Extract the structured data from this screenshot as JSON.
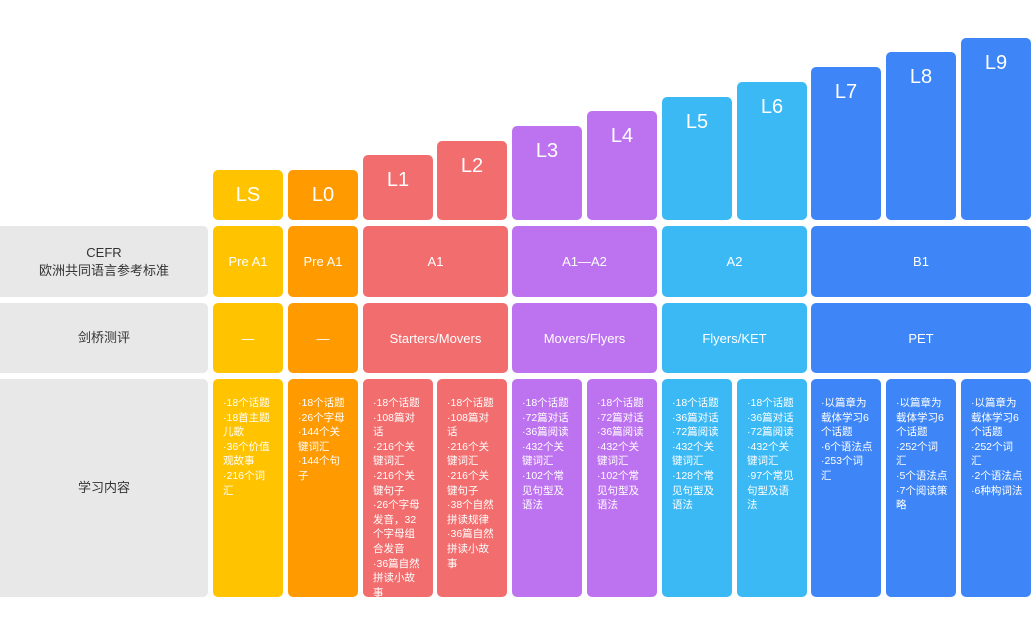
{
  "row_labels": {
    "cefr": "CEFR\n欧洲共同语言参考标准",
    "cambridge": "剑桥测评",
    "content": "学习内容"
  },
  "colors": {
    "yellow": "#FFC300",
    "orange": "#FF9A00",
    "red": "#F26D6D",
    "purple": "#BD73F0",
    "cyan": "#3BB9F5",
    "blue": "#3E86F7",
    "label_bg": "#E8E8E8"
  },
  "levels": [
    {
      "name": "LS",
      "color": "#FFC300",
      "content": "·18个话题\n·18首主题儿歌\n·36个价值观故事\n·216个词汇"
    },
    {
      "name": "L0",
      "color": "#FF9A00",
      "content": "·18个话题\n·26个字母\n·144个关键词汇\n·144个句子"
    },
    {
      "name": "L1",
      "color": "#F26D6D",
      "content": "·18个话题\n·108篇对话\n·216个关键词汇\n·216个关键句子\n·26个字母发音，32个字母组合发音\n·36篇自然拼读小故事"
    },
    {
      "name": "L2",
      "color": "#F26D6D",
      "content": "·18个话题\n·108篇对话\n·216个关键词汇\n·216个关键句子\n·38个自然拼读规律\n·36篇自然拼读小故事"
    },
    {
      "name": "L3",
      "color": "#BD73F0",
      "content": "·18个话题\n·72篇对话\n·36篇阅读\n·432个关键词汇\n·102个常见句型及语法"
    },
    {
      "name": "L4",
      "color": "#BD73F0",
      "content": "·18个话题\n·72篇对话\n·36篇阅读\n·432个关键词汇\n·102个常见句型及语法"
    },
    {
      "name": "L5",
      "color": "#3BB9F5",
      "content": "·18个话题\n·36篇对话\n·72篇阅读\n·432个关键词汇\n·128个常见句型及语法"
    },
    {
      "name": "L6",
      "color": "#3BB9F5",
      "content": "·18个话题\n·36篇对话\n·72篇阅读\n·432个关键词汇\n·97个常见句型及语法"
    },
    {
      "name": "L7",
      "color": "#3E86F7",
      "content": "·以篇章为载体学习6个话题\n·6个语法点\n·253个词汇"
    },
    {
      "name": "L8",
      "color": "#3E86F7",
      "content": "·以篇章为载体学习6个话题\n·252个词汇\n·5个语法点\n·7个阅读策略"
    },
    {
      "name": "L9",
      "color": "#3E86F7",
      "content": "·以篇章为载体学习6个话题\n·252个词汇\n·2个语法点\n·6种构词法"
    }
  ],
  "cefr": [
    {
      "label": "Pre A1",
      "start": 0,
      "span": 1,
      "color": "#FFC300"
    },
    {
      "label": "Pre A1",
      "start": 1,
      "span": 1,
      "color": "#FF9A00"
    },
    {
      "label": "A1",
      "start": 2,
      "span": 2,
      "color": "#F26D6D"
    },
    {
      "label": "A1—A2",
      "start": 4,
      "span": 2,
      "color": "#BD73F0"
    },
    {
      "label": "A2",
      "start": 6,
      "span": 2,
      "color": "#3BB9F5"
    },
    {
      "label": "B1",
      "start": 8,
      "span": 3,
      "color": "#3E86F7"
    }
  ],
  "cambridge": [
    {
      "label": "—",
      "start": 0,
      "span": 1,
      "color": "#FFC300"
    },
    {
      "label": "—",
      "start": 1,
      "span": 1,
      "color": "#FF9A00"
    },
    {
      "label": "Starters/Movers",
      "start": 2,
      "span": 2,
      "color": "#F26D6D"
    },
    {
      "label": "Movers/Flyers",
      "start": 4,
      "span": 2,
      "color": "#BD73F0"
    },
    {
      "label": "Flyers/KET",
      "start": 6,
      "span": 2,
      "color": "#3BB9F5"
    },
    {
      "label": "PET",
      "start": 8,
      "span": 3,
      "color": "#3E86F7"
    }
  ]
}
